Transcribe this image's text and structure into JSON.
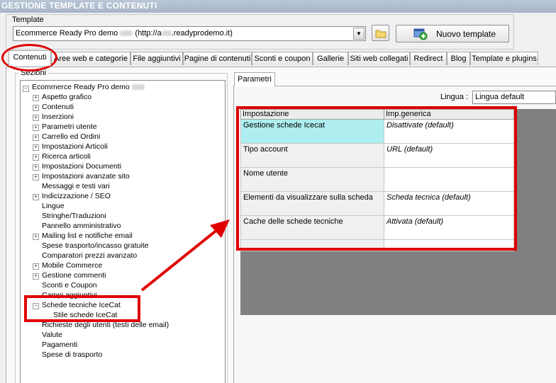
{
  "window": {
    "title": "GESTIONE TEMPLATE E CONTENUTI"
  },
  "template": {
    "group_label": "Template",
    "select_before": "Ecommerce Ready Pro demo",
    "select_middle": " (http://a",
    "select_after": ".readyprodemo.it)",
    "new_template_label": "Nuovo template"
  },
  "tabs": [
    "Contenuti",
    "Aree web e categorie",
    "File aggiuntivi",
    "Pagine di contenuti",
    "Sconti e coupon",
    "Gallerie",
    "Siti web collegati",
    "Redirect",
    "Blog",
    "Template e plugins"
  ],
  "sections": {
    "group_label": "Sezioni",
    "root": "Ecommerce Ready Pro demo",
    "items": [
      {
        "label": "Aspetto grafico",
        "expander": "+"
      },
      {
        "label": "Contenuti",
        "expander": "+"
      },
      {
        "label": "Inserzioni",
        "expander": "+"
      },
      {
        "label": "Parametri utente",
        "expander": "+"
      },
      {
        "label": "Carrello ed Ordini",
        "expander": "+"
      },
      {
        "label": "Impostazioni Articoli",
        "expander": "+"
      },
      {
        "label": "Ricerca articoli",
        "expander": "+"
      },
      {
        "label": "Impostazioni Documenti",
        "expander": "+"
      },
      {
        "label": "Impostazioni avanzate sito",
        "expander": "+"
      },
      {
        "label": "Messaggi e testi vari",
        "expander": ""
      },
      {
        "label": "Indicizzazione / SEO",
        "expander": "+"
      },
      {
        "label": "Lingue",
        "expander": ""
      },
      {
        "label": "Stringhe/Traduzioni",
        "expander": ""
      },
      {
        "label": "Pannello amministrativo",
        "expander": ""
      },
      {
        "label": "Mailing list e notifiche email",
        "expander": "+"
      },
      {
        "label": "Spese trasporto/incasso gratuite",
        "expander": ""
      },
      {
        "label": "Comparatori prezzi avanzato",
        "expander": ""
      },
      {
        "label": "Mobile Commerce",
        "expander": "+"
      },
      {
        "label": "Gestione commenti",
        "expander": "+"
      },
      {
        "label": "Sconti e Coupon",
        "expander": ""
      },
      {
        "label": "Campi aggiuntivi",
        "expander": ""
      },
      {
        "label": "Schede tecniche IceCat",
        "expander": "−"
      },
      {
        "label": "Stile schede IceCat",
        "expander": "",
        "child": true
      },
      {
        "label": "Richieste degli utenti (testi delle email)",
        "expander": ""
      },
      {
        "label": "Valute",
        "expander": ""
      },
      {
        "label": "Pagamenti",
        "expander": ""
      },
      {
        "label": "Spese di trasporto",
        "expander": ""
      }
    ]
  },
  "params": {
    "tab_label": "Parametri",
    "lingua_label": "Lingua :",
    "lingua_value": "Lingua default",
    "columns": [
      "Impostazione",
      "Imp.generica"
    ],
    "rows": [
      {
        "setting": "Gestione schede Icecat",
        "value": "Disattivate (default)"
      },
      {
        "setting": "Tipo account",
        "value": "URL (default)"
      },
      {
        "setting": "Nome utente",
        "value": ""
      },
      {
        "setting": "Elementi da visualizzare sulla scheda",
        "value": "Scheda tecnica (default)"
      },
      {
        "setting": "Cache delle schede tecniche",
        "value": "Attivata (default)"
      },
      {
        "setting": "",
        "value": ""
      }
    ]
  },
  "colors": {
    "annotation_red": "#e00000",
    "selected_cell": "#aeeef0",
    "titlebar": "#a6b5c8"
  },
  "icons": {
    "folder": "folder-icon",
    "new_template": "add-template-icon",
    "dropdown": "chevron-down-icon"
  }
}
